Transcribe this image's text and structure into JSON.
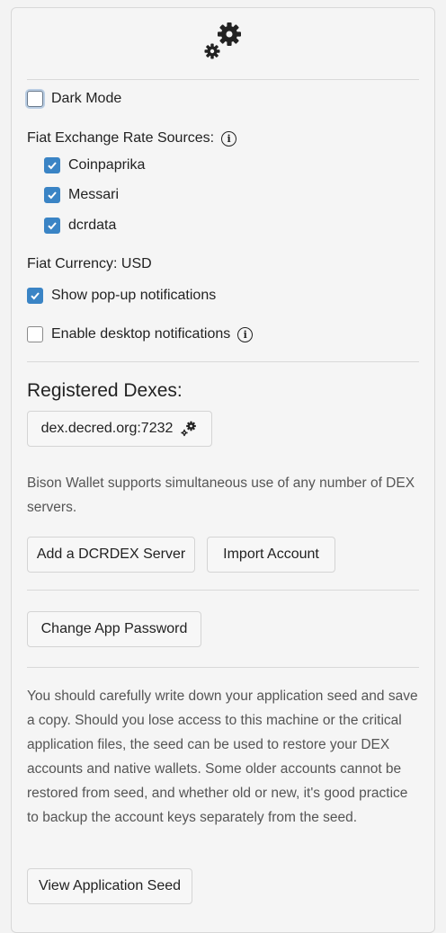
{
  "settings": {
    "dark_mode_label": "Dark Mode",
    "fiat_sources_label": "Fiat Exchange Rate Sources:",
    "sources": [
      {
        "label": "Coinpaprika",
        "checked": true
      },
      {
        "label": "Messari",
        "checked": true
      },
      {
        "label": "dcrdata",
        "checked": true
      }
    ],
    "fiat_currency_label": "Fiat Currency: USD",
    "popup_label": "Show pop-up notifications",
    "desktop_label": "Enable desktop notifications"
  },
  "dexes": {
    "heading": "Registered Dexes:",
    "host": "dex.decred.org:7232",
    "description": "Bison Wallet supports simultaneous use of any number of DEX servers.",
    "add_server_label": "Add a DCRDEX Server",
    "import_label": "Import Account"
  },
  "security": {
    "change_password_label": "Change App Password",
    "seed_description": "You should carefully write down your application seed and save a copy. Should you lose access to this machine or the critical application files, the seed can be used to restore your DEX accounts and native wallets. Some older accounts cannot be restored from seed, and whether old or new, it's good practice to backup the account keys separately from the seed.",
    "view_seed_label": "View Application Seed"
  },
  "colors": {
    "checkbox_accent": "#3a84c5",
    "background": "#f3f3f3"
  }
}
